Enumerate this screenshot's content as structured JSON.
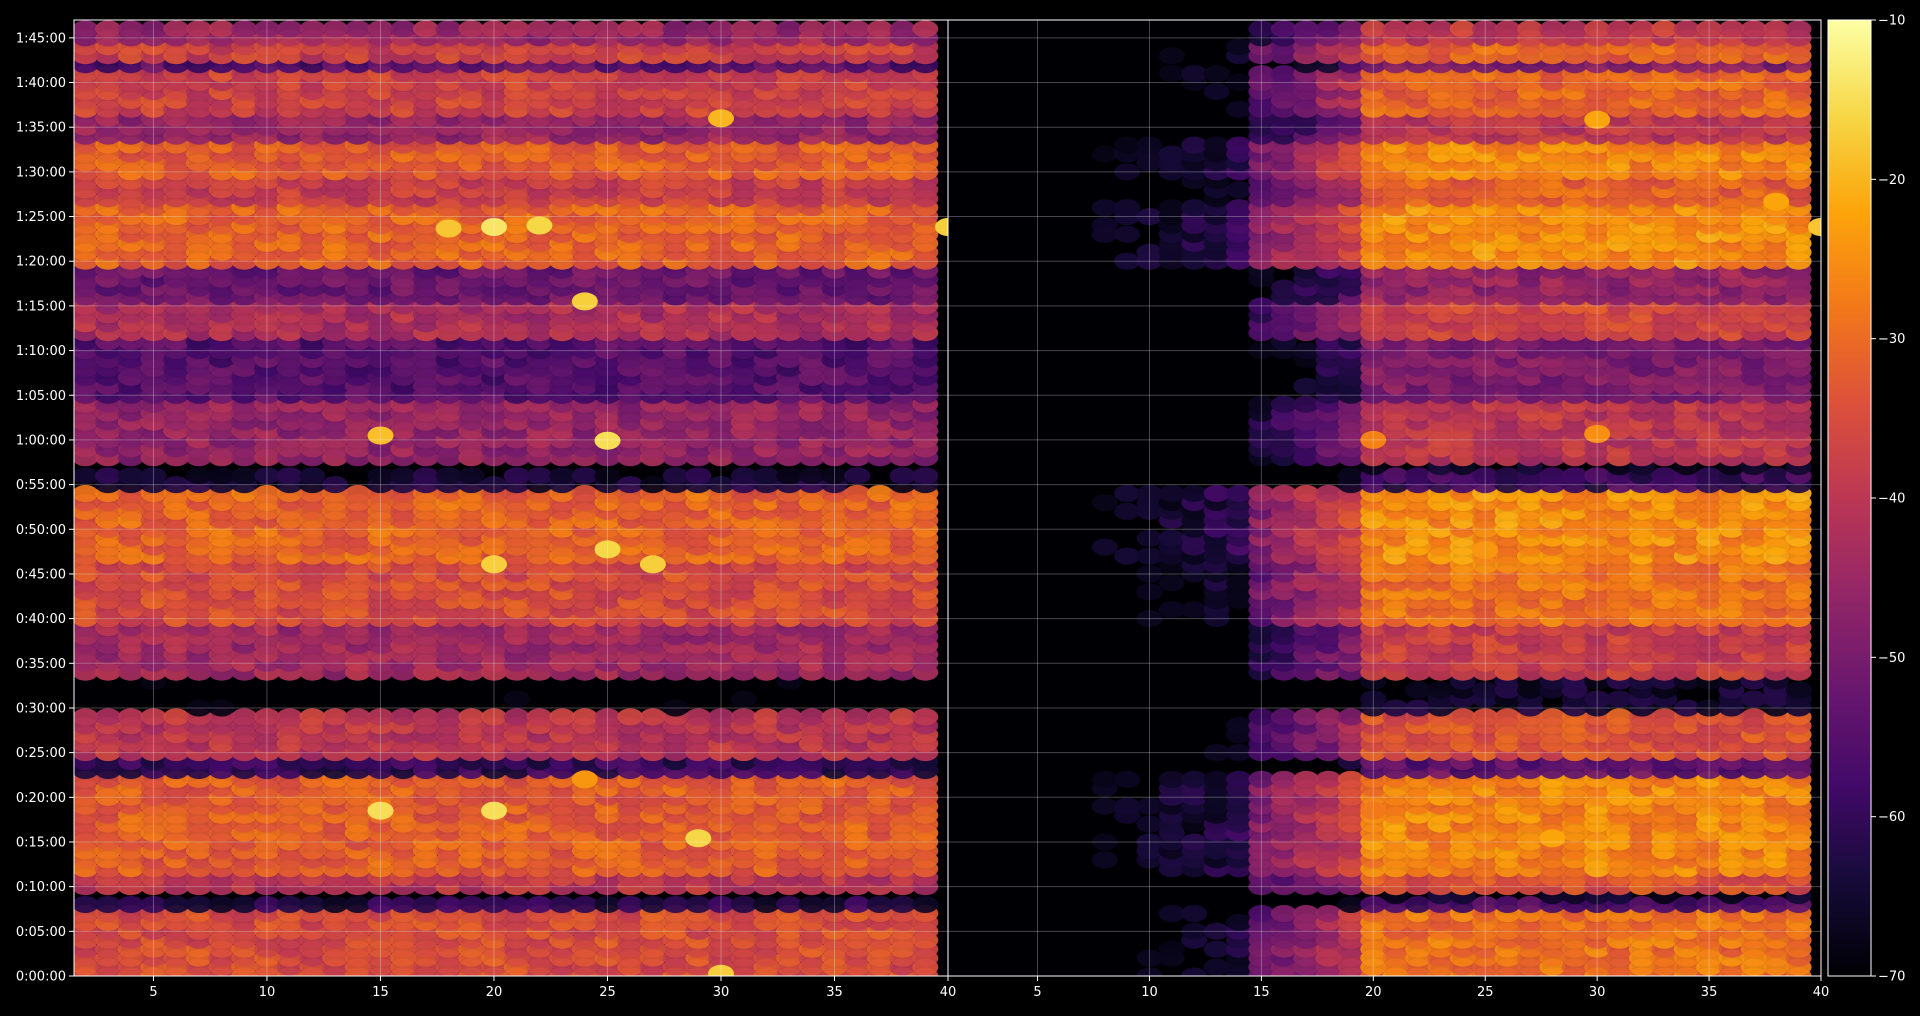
{
  "chart_data": {
    "type": "heatmap",
    "title": "",
    "colormap": "inferno",
    "panels": [
      {
        "xlabel": "",
        "ylabel": "",
        "xlim": [
          1.5,
          40
        ],
        "x_ticks": [
          5,
          10,
          15,
          20,
          25,
          30,
          35,
          40
        ],
        "x_tick_labels": [
          "5",
          "10",
          "15",
          "20",
          "25",
          "30",
          "35",
          "40"
        ],
        "columns": [
          2,
          39
        ],
        "intensity": "high"
      },
      {
        "xlabel": "",
        "ylabel": "",
        "xlim": [
          1,
          40
        ],
        "x_ticks": [
          5,
          10,
          15,
          20,
          25,
          30,
          35,
          40
        ],
        "x_tick_labels": [
          "5",
          "10",
          "15",
          "20",
          "25",
          "30",
          "35",
          "40"
        ],
        "columns": [
          2,
          39
        ],
        "intensity": "low-left-fading"
      }
    ],
    "y_axis": {
      "unit": "seconds",
      "ylim": [
        0,
        6420
      ],
      "ticks": [
        0,
        300,
        600,
        900,
        1200,
        1500,
        1800,
        2100,
        2400,
        2700,
        3000,
        3300,
        3600,
        3900,
        4200,
        4500,
        4800,
        5100,
        5400,
        5700,
        6000,
        6300
      ],
      "tick_labels": [
        "0:00:00",
        "0:05:00",
        "0:10:00",
        "0:15:00",
        "0:20:00",
        "0:25:00",
        "0:30:00",
        "0:35:00",
        "0:40:00",
        "0:45:00",
        "0:50:00",
        "0:55:00",
        "1:00:00",
        "1:05:00",
        "1:10:00",
        "1:15:00",
        "1:20:00",
        "1:25:00",
        "1:30:00",
        "1:35:00",
        "1:40:00",
        "1:45:00"
      ]
    },
    "colorbar": {
      "range": [
        -70,
        -10
      ],
      "ticks": [
        -10,
        -20,
        -30,
        -40,
        -50,
        -60,
        -70
      ],
      "tick_labels": [
        "−10",
        "−20",
        "−30",
        "−40",
        "−50",
        "−60",
        "−70"
      ]
    },
    "activity_bands": [
      {
        "start_s": 0,
        "end_s": 430,
        "level": -35
      },
      {
        "start_s": 430,
        "end_s": 540,
        "level": -62
      },
      {
        "start_s": 560,
        "end_s": 720,
        "level": -40
      },
      {
        "start_s": 720,
        "end_s": 1380,
        "level": -32
      },
      {
        "start_s": 1380,
        "end_s": 1450,
        "level": -60
      },
      {
        "start_s": 1500,
        "end_s": 1800,
        "level": -40
      },
      {
        "start_s": 1800,
        "end_s": 2030,
        "level": -72
      },
      {
        "start_s": 2030,
        "end_s": 2380,
        "level": -44
      },
      {
        "start_s": 2380,
        "end_s": 2800,
        "level": -35
      },
      {
        "start_s": 2800,
        "end_s": 3300,
        "level": -31
      },
      {
        "start_s": 3300,
        "end_s": 3400,
        "level": -65
      },
      {
        "start_s": 3430,
        "end_s": 3850,
        "level": -46
      },
      {
        "start_s": 3850,
        "end_s": 4300,
        "level": -55
      },
      {
        "start_s": 4300,
        "end_s": 4540,
        "level": -42
      },
      {
        "start_s": 4540,
        "end_s": 4800,
        "level": -52
      },
      {
        "start_s": 4800,
        "end_s": 5220,
        "level": -31
      },
      {
        "start_s": 5220,
        "end_s": 5400,
        "level": -38
      },
      {
        "start_s": 5400,
        "end_s": 5640,
        "level": -32
      },
      {
        "start_s": 5640,
        "end_s": 5780,
        "level": -46
      },
      {
        "start_s": 5780,
        "end_s": 6080,
        "level": -37
      },
      {
        "start_s": 6080,
        "end_s": 6150,
        "level": -55
      },
      {
        "start_s": 6150,
        "end_s": 6300,
        "level": -37
      },
      {
        "start_s": 6300,
        "end_s": 6380,
        "level": -45
      }
    ],
    "hot_spots": [
      {
        "panel": 0,
        "x": 20,
        "t": 5030,
        "value": -14
      },
      {
        "panel": 0,
        "x": 22,
        "t": 5040,
        "value": -16
      },
      {
        "panel": 0,
        "x": 18,
        "t": 5020,
        "value": -18
      },
      {
        "panel": 0,
        "x": 24,
        "t": 4530,
        "value": -17
      },
      {
        "panel": 0,
        "x": 25,
        "t": 3595,
        "value": -15
      },
      {
        "panel": 0,
        "x": 15,
        "t": 3630,
        "value": -19
      },
      {
        "panel": 0,
        "x": 25,
        "t": 2865,
        "value": -16
      },
      {
        "panel": 0,
        "x": 20,
        "t": 2765,
        "value": -17
      },
      {
        "panel": 0,
        "x": 27,
        "t": 2765,
        "value": -17
      },
      {
        "panel": 0,
        "x": 15,
        "t": 1110,
        "value": -15
      },
      {
        "panel": 0,
        "x": 20,
        "t": 1110,
        "value": -15
      },
      {
        "panel": 0,
        "x": 29,
        "t": 925,
        "value": -16
      },
      {
        "panel": 0,
        "x": 30,
        "t": 15,
        "value": -17
      },
      {
        "panel": 0,
        "x": 24,
        "t": 1320,
        "value": -24
      },
      {
        "panel": 0,
        "x": 30,
        "t": 5760,
        "value": -20
      },
      {
        "panel": 0,
        "x": 40,
        "t": 5030,
        "value": -17
      },
      {
        "panel": 1,
        "x": 40,
        "t": 5030,
        "value": -18
      },
      {
        "panel": 1,
        "x": 30,
        "t": 5750,
        "value": -22
      },
      {
        "panel": 1,
        "x": 38,
        "t": 5200,
        "value": -22
      },
      {
        "panel": 1,
        "x": 20,
        "t": 3600,
        "value": -27
      },
      {
        "panel": 1,
        "x": 30,
        "t": 3640,
        "value": -25
      },
      {
        "panel": 1,
        "x": 28,
        "t": 925,
        "value": -22
      },
      {
        "panel": 1,
        "x": 25,
        "t": 2860,
        "value": -24
      },
      {
        "panel": 1,
        "x": 20,
        "t": 1110,
        "value": -28
      }
    ]
  }
}
